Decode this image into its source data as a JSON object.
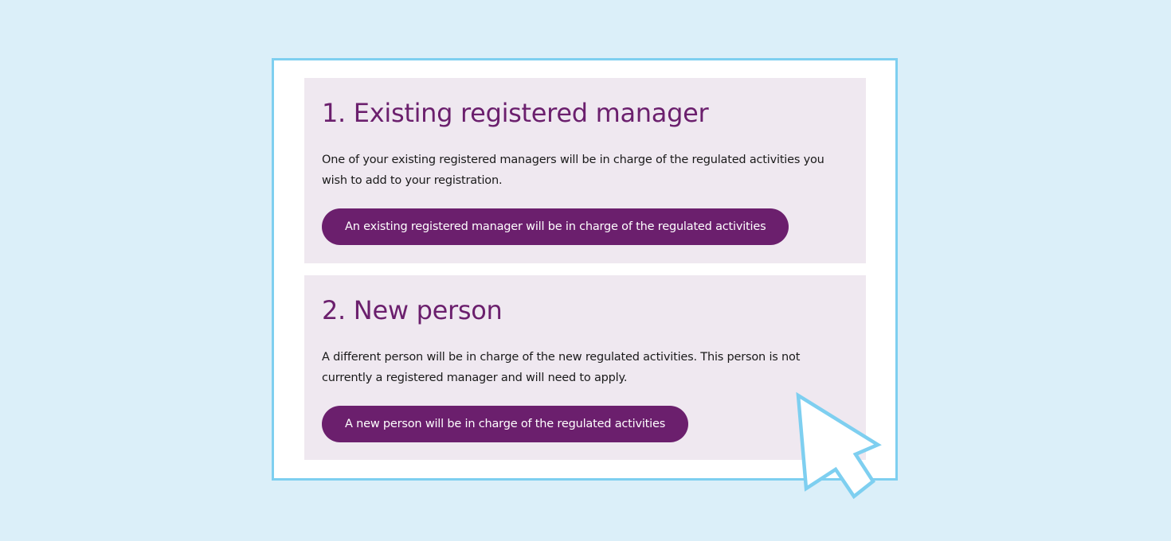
{
  "options": [
    {
      "title": "1. Existing registered manager",
      "text": "One of your existing registered managers will be in charge of the regulated activities you wish to add to your registration.",
      "button_label": "An existing registered manager will be in charge of the regulated activities"
    },
    {
      "title": "2. New person",
      "text": "A different person will be in charge of the new regulated activities. This person is not currently a registered manager and will need to apply.",
      "button_label": "A new person will be in charge of the regulated activities"
    }
  ],
  "colors": {
    "background": "#dbeff9",
    "frame_border": "#7ecff0",
    "card_background": "#efe8f0",
    "accent": "#6b1f6d",
    "cursor_outline": "#7ecff0"
  },
  "icons": {
    "pointer": "mouse-pointer-arrow-icon"
  }
}
